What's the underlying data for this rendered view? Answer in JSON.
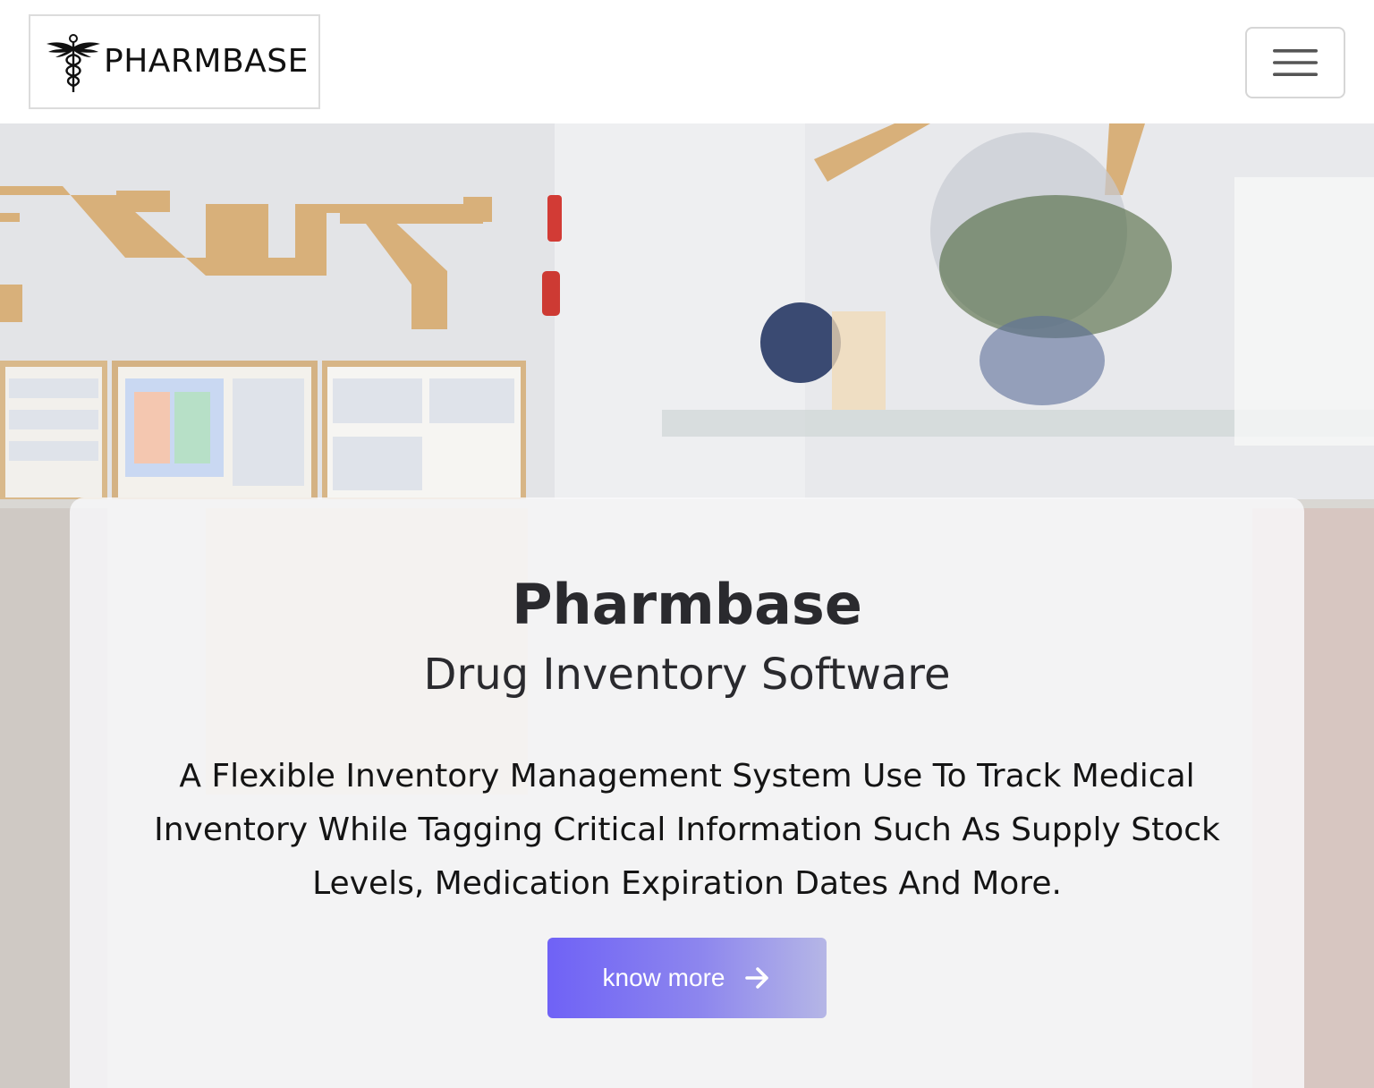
{
  "navbar": {
    "brand_text": "PHARMBASE",
    "brand_logo_icon": "caduceus-icon",
    "menu_icon": "hamburger-menu-icon"
  },
  "hero": {
    "title": "Pharmbase",
    "subtitle": "Drug Inventory Software",
    "description": "A Flexible Inventory Management System Use To Track Medical Inventory While Tagging Critical Information Such As Supply Stock Levels, Medication Expiration Dates And More.",
    "cta_label": "know more",
    "cta_icon": "arrow-right-icon"
  },
  "colors": {
    "cta_gradient_start": "#6f62f6",
    "cta_gradient_end": "#b5b6e6",
    "card_background": "#f8f8fa",
    "text_dark": "#2a2a2e"
  }
}
